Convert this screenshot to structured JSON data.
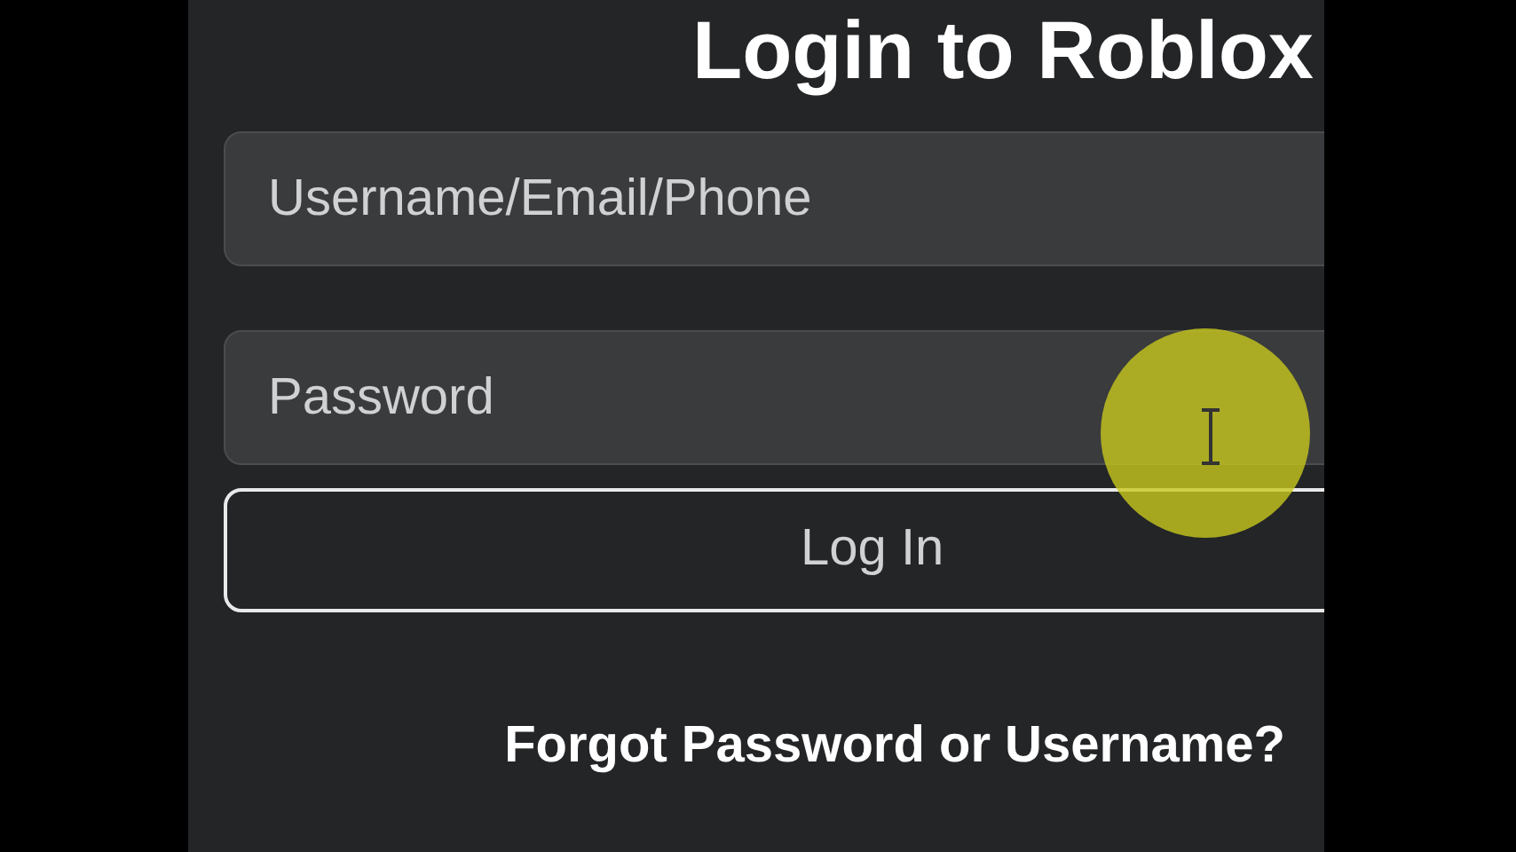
{
  "heading": "Login to Roblox",
  "fields": [
    {
      "placeholder": "Username/Email/Phone"
    },
    {
      "placeholder": "Password"
    }
  ],
  "login_button": "Log In",
  "forgot_link": "Forgot Password or Username?"
}
